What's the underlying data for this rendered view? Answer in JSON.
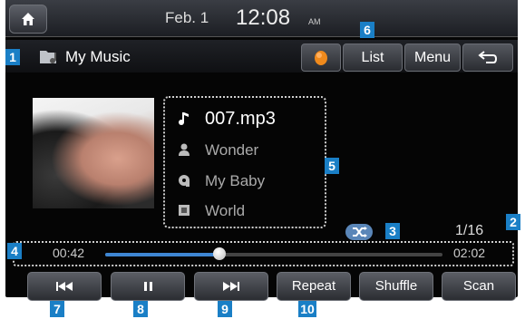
{
  "status": {
    "date": "Feb.  1",
    "time": "12:08",
    "ampm": "AM"
  },
  "header": {
    "title": "My Music",
    "list_label": "List",
    "menu_label": "Menu"
  },
  "track": {
    "file": "007.mp3",
    "artist": "Wonder",
    "album": "My Baby",
    "genre": "World",
    "count": "1/16"
  },
  "progress": {
    "elapsed": "00:42",
    "total": "02:02",
    "fraction": 0.34
  },
  "controls": {
    "repeat": "Repeat",
    "shuffle": "Shuffle",
    "scan": "Scan"
  },
  "callouts": [
    "1",
    "2",
    "3",
    "4",
    "5",
    "6",
    "7",
    "8",
    "9",
    "10"
  ],
  "colors": {
    "accent": "#1a7fc6",
    "progress": "#3e86d3"
  },
  "icons": [
    "home-icon",
    "folder-music-icon",
    "source-icon",
    "back-icon",
    "note-icon",
    "person-icon",
    "album-icon",
    "genre-icon",
    "shuffle-icon",
    "prev-icon",
    "pause-icon",
    "next-icon"
  ]
}
